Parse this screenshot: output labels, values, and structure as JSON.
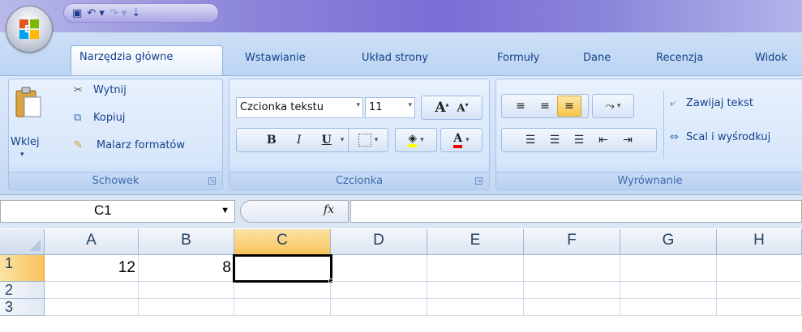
{
  "qat": {
    "save_icon": "save-icon",
    "undo_icon": "undo-icon",
    "redo_icon": "redo-icon",
    "customize_icon": "customize-qat-icon"
  },
  "tabs": [
    "Narzędzia główne",
    "Wstawianie",
    "Układ strony",
    "Formuły",
    "Dane",
    "Recenzja",
    "Widok"
  ],
  "ribbon": {
    "clipboard": {
      "paste": "Wklej",
      "cut": "Wytnij",
      "copy": "Kopiuj",
      "format_painter": "Malarz formatów",
      "label": "Schowek"
    },
    "font": {
      "name": "Czcionka tekstu",
      "size": "11",
      "bold": "B",
      "italic": "I",
      "underline": "U",
      "grow": "A",
      "shrink": "A",
      "color_letter": "A",
      "label": "Czcionka"
    },
    "alignment": {
      "wrap": "Zawijaj tekst",
      "merge": "Scal i wyśrodkuj",
      "label": "Wyrównanie"
    }
  },
  "formula_bar": {
    "name_box": "C1",
    "fx": "fx",
    "formula": ""
  },
  "grid": {
    "columns": [
      "A",
      "B",
      "C",
      "D",
      "E",
      "F",
      "G",
      "H"
    ],
    "rows": [
      "1",
      "2",
      "3"
    ],
    "cells": {
      "A1": "12",
      "B1": "8"
    },
    "selected": "C1"
  },
  "colors": {
    "accent": "#15428b",
    "ribbon_bg": "#cfe0f6",
    "selection": "#f7c35d"
  }
}
